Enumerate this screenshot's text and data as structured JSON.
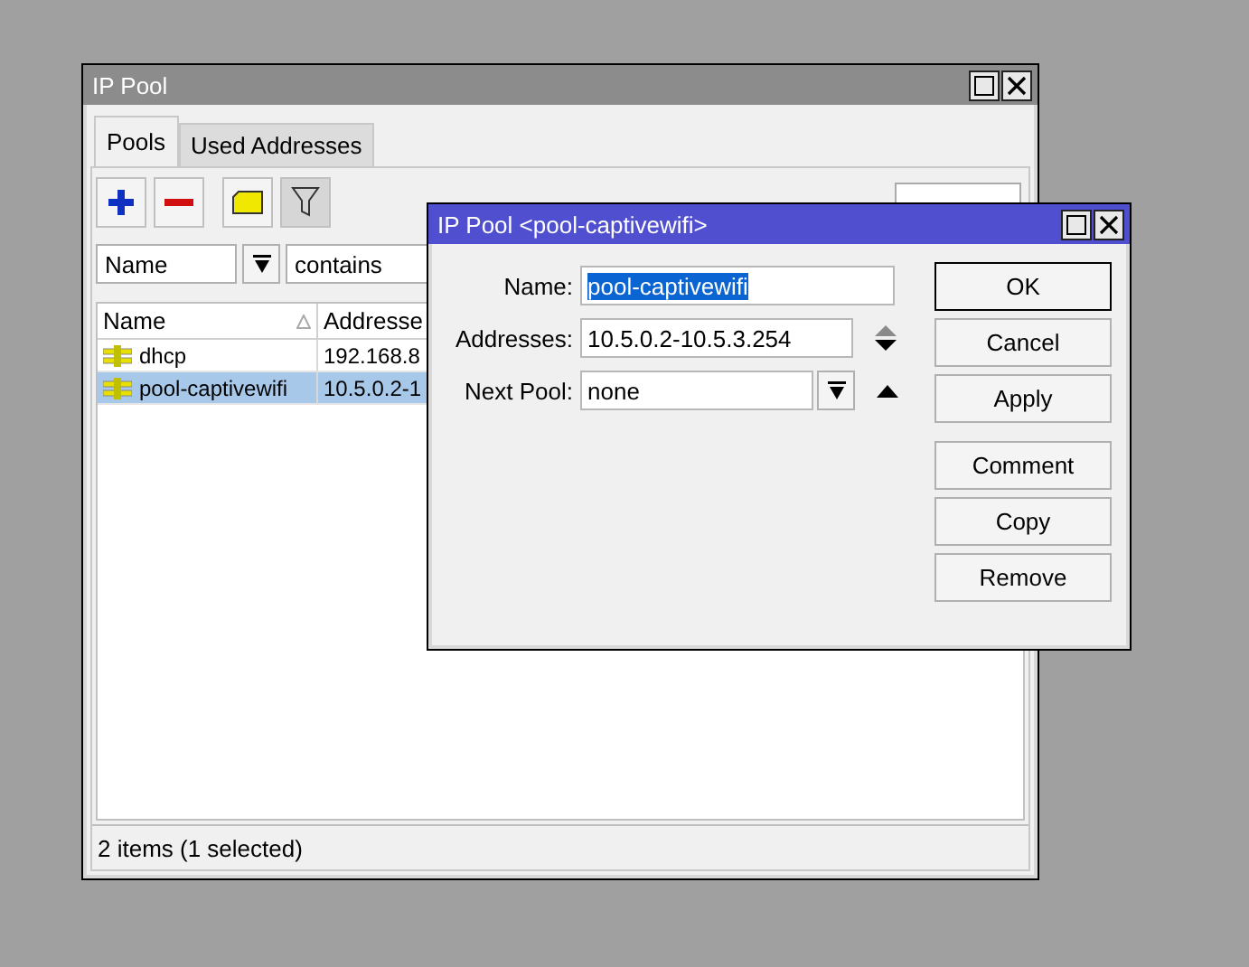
{
  "main_window": {
    "title": "IP Pool",
    "tabs": [
      {
        "label": "Pools",
        "selected": true
      },
      {
        "label": "Used Addresses",
        "selected": false
      }
    ],
    "filter": {
      "field": "Name",
      "operator": "contains"
    },
    "table": {
      "columns": [
        "Name",
        "Addresse"
      ],
      "rows": [
        {
          "cells": [
            "dhcp",
            "192.168.8"
          ],
          "selected": false
        },
        {
          "cells": [
            "pool-captivewifi",
            "10.5.0.2-1"
          ],
          "selected": true
        }
      ]
    },
    "status_bar": "2 items (1 selected)"
  },
  "dialog": {
    "title": "IP Pool <pool-captivewifi>",
    "fields": [
      {
        "kind": "text",
        "label": "Name:",
        "value": "pool-captivewifi",
        "text_selected": true
      },
      {
        "kind": "spin",
        "label": "Addresses:",
        "value": "10.5.0.2-10.5.3.254",
        "text_selected": false
      },
      {
        "kind": "dropdown",
        "label": "Next Pool:",
        "value": "none",
        "text_selected": false
      }
    ],
    "buttons": [
      {
        "label": "OK",
        "default": true
      },
      {
        "label": "Cancel",
        "default": false
      },
      {
        "label": "Apply",
        "default": false
      }
    ],
    "more_buttons": [
      {
        "label": "Comment"
      },
      {
        "label": "Copy"
      },
      {
        "label": "Remove"
      }
    ]
  }
}
